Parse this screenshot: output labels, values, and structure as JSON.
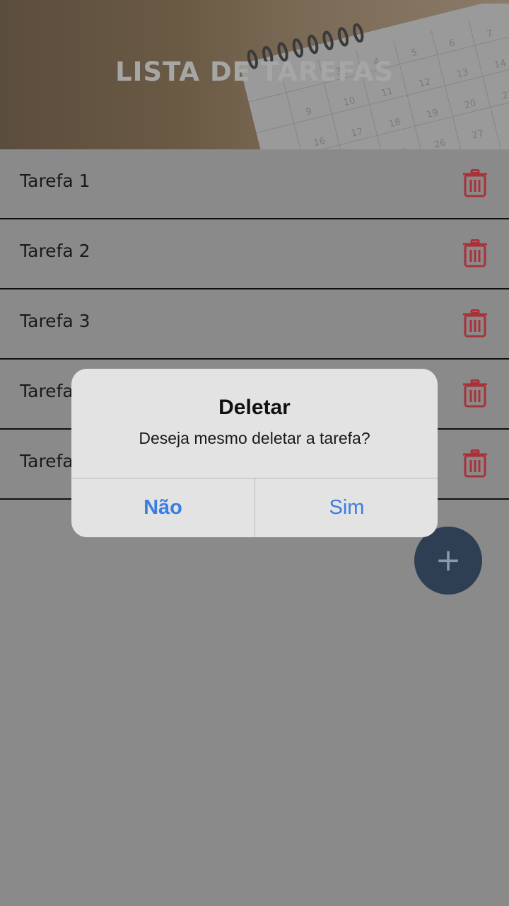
{
  "header": {
    "title": "LISTA DE TAREFAS",
    "background_image": "calendar-photo"
  },
  "tasks": [
    {
      "label": "Tarefa 1",
      "delete_icon": "trash-icon"
    },
    {
      "label": "Tarefa 2",
      "delete_icon": "trash-icon"
    },
    {
      "label": "Tarefa 3",
      "delete_icon": "trash-icon"
    },
    {
      "label": "Tarefa 4",
      "delete_icon": "trash-icon"
    },
    {
      "label": "Tarefa 5",
      "delete_icon": "trash-icon"
    }
  ],
  "fab": {
    "icon": "plus-icon",
    "symbol": "+"
  },
  "dialog": {
    "title": "Deletar",
    "message": "Deseja mesmo deletar a tarefa?",
    "cancel_label": "Não",
    "confirm_label": "Sim"
  },
  "colors": {
    "overlay_background": "#8a8a8a",
    "delete_icon": "#a8323a",
    "dialog_button_text": "#3a7ee0",
    "fab_background": "#2e3f54"
  }
}
